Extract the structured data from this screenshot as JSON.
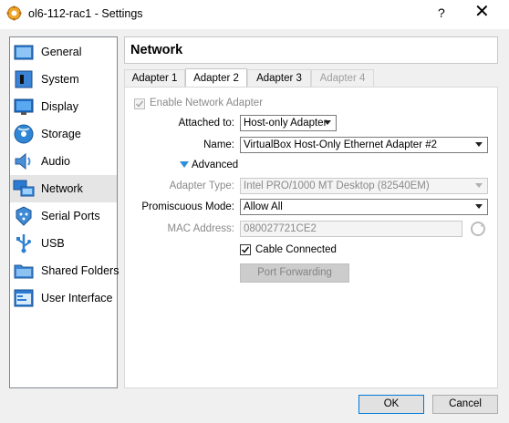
{
  "window": {
    "title": "ol6-112-rac1 - Settings",
    "help_label": "?",
    "close_label": "✕"
  },
  "sidebar": {
    "items": [
      {
        "label": "General",
        "icon": "general-icon"
      },
      {
        "label": "System",
        "icon": "system-icon"
      },
      {
        "label": "Display",
        "icon": "display-icon"
      },
      {
        "label": "Storage",
        "icon": "storage-icon"
      },
      {
        "label": "Audio",
        "icon": "audio-icon"
      },
      {
        "label": "Network",
        "icon": "network-icon",
        "selected": true
      },
      {
        "label": "Serial Ports",
        "icon": "serial-ports-icon"
      },
      {
        "label": "USB",
        "icon": "usb-icon"
      },
      {
        "label": "Shared Folders",
        "icon": "shared-folders-icon"
      },
      {
        "label": "User Interface",
        "icon": "user-interface-icon"
      }
    ]
  },
  "page": {
    "title": "Network"
  },
  "tabs": [
    {
      "label": "Adapter 1"
    },
    {
      "label": "Adapter 2",
      "active": true
    },
    {
      "label": "Adapter 3"
    },
    {
      "label": "Adapter 4",
      "disabled": true
    }
  ],
  "form": {
    "enable_label": "Enable Network Adapter",
    "attached_label": "Attached to:",
    "attached_value": "Host-only Adapter",
    "name_label": "Name:",
    "name_value": "VirtualBox Host-Only Ethernet Adapter #2",
    "advanced_label": "Advanced",
    "adapter_type_label": "Adapter Type:",
    "adapter_type_value": "Intel PRO/1000 MT Desktop (82540EM)",
    "promiscuous_label": "Promiscuous Mode:",
    "promiscuous_value": "Allow All",
    "mac_label": "MAC Address:",
    "mac_value": "080027721CE2",
    "cable_label": "Cable Connected",
    "port_forwarding_label": "Port Forwarding"
  },
  "footer": {
    "ok_label": "OK",
    "cancel_label": "Cancel"
  },
  "colors": {
    "accent": "#0078d7",
    "selected_item": "#e5e5e5",
    "advanced_arrow": "#2f8fd8"
  }
}
